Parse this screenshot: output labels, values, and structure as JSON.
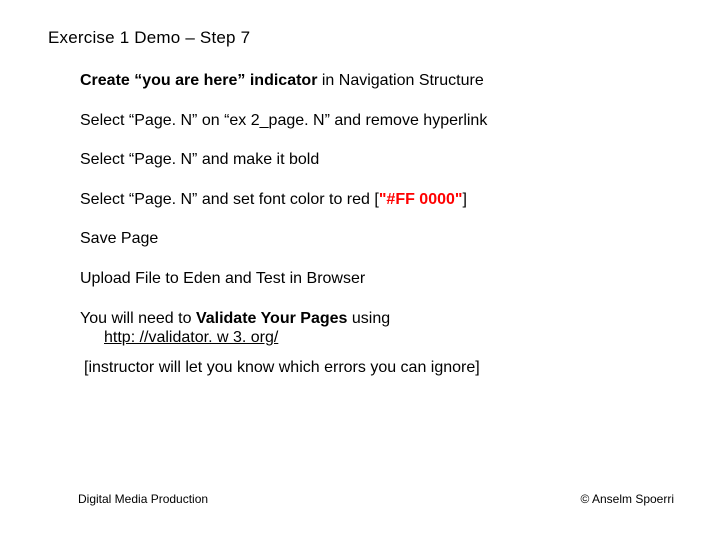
{
  "title": "Exercise 1 Demo – Step 7",
  "line1_bold": "Create “you are here” indicator",
  "line1_rest": " in Navigation Structure",
  "line2": "Select “Page. N” on “ex 2_page. N” and remove hyperlink",
  "line3": "Select “Page. N” and make it bold",
  "line4_pre": "Select “Page. N” and set font color to red [",
  "line4_red": "\"#FF 0000\"",
  "line4_post": "]",
  "line5": "Save Page",
  "line6": "Upload File to Eden and Test in Browser",
  "line7_pre": "You will need to ",
  "line7_bold": "Validate Your Pages",
  "line7_post": " using",
  "line7_link": "http: //validator. w 3. org/",
  "line8": "[instructor will let you know which errors you can ignore]",
  "footer_left": "Digital Media Production",
  "footer_right": "© Anselm Spoerri"
}
